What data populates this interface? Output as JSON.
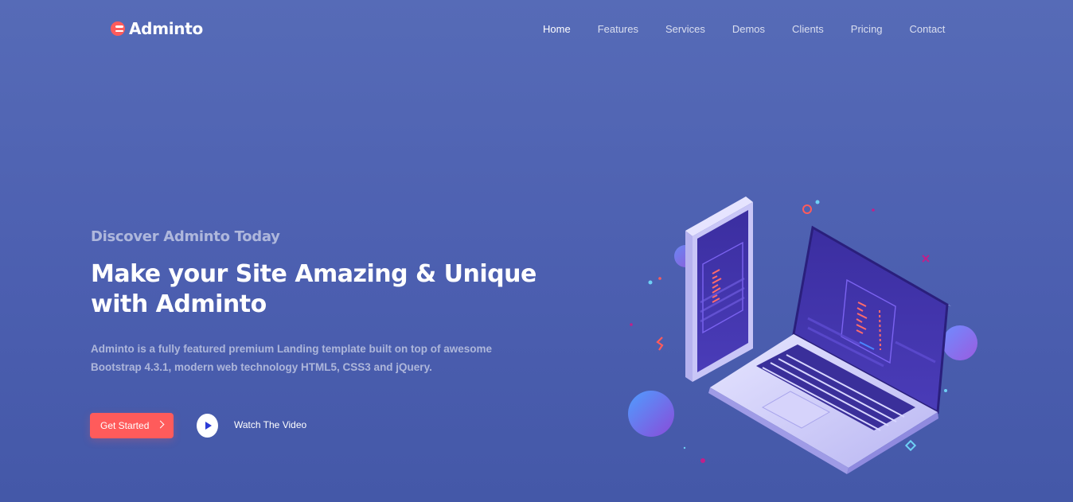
{
  "brand": {
    "name": "Adminto",
    "logo_icon": "adminto-logo-icon",
    "accent": "#ff5b5b"
  },
  "nav": {
    "items": [
      {
        "label": "Home",
        "active": true
      },
      {
        "label": "Features",
        "active": false
      },
      {
        "label": "Services",
        "active": false
      },
      {
        "label": "Demos",
        "active": false
      },
      {
        "label": "Clients",
        "active": false
      },
      {
        "label": "Pricing",
        "active": false
      },
      {
        "label": "Contact",
        "active": false
      }
    ]
  },
  "hero": {
    "subtitle": "Discover Adminto Today",
    "title": "Make your Site Amazing & Unique with Adminto",
    "description": "Adminto is a fully featured premium Landing template built on top of awesome Bootstrap 4.3.1, modern web technology HTML5, CSS3 and jQuery.",
    "cta_label": "Get Started",
    "video_label": "Watch The Video"
  },
  "colors": {
    "background_top": "#566bb7",
    "background_bottom": "#4458a8",
    "button": "#ff5b5b"
  },
  "illustration": {
    "icon": "laptop-phone-isometric-illustration"
  }
}
